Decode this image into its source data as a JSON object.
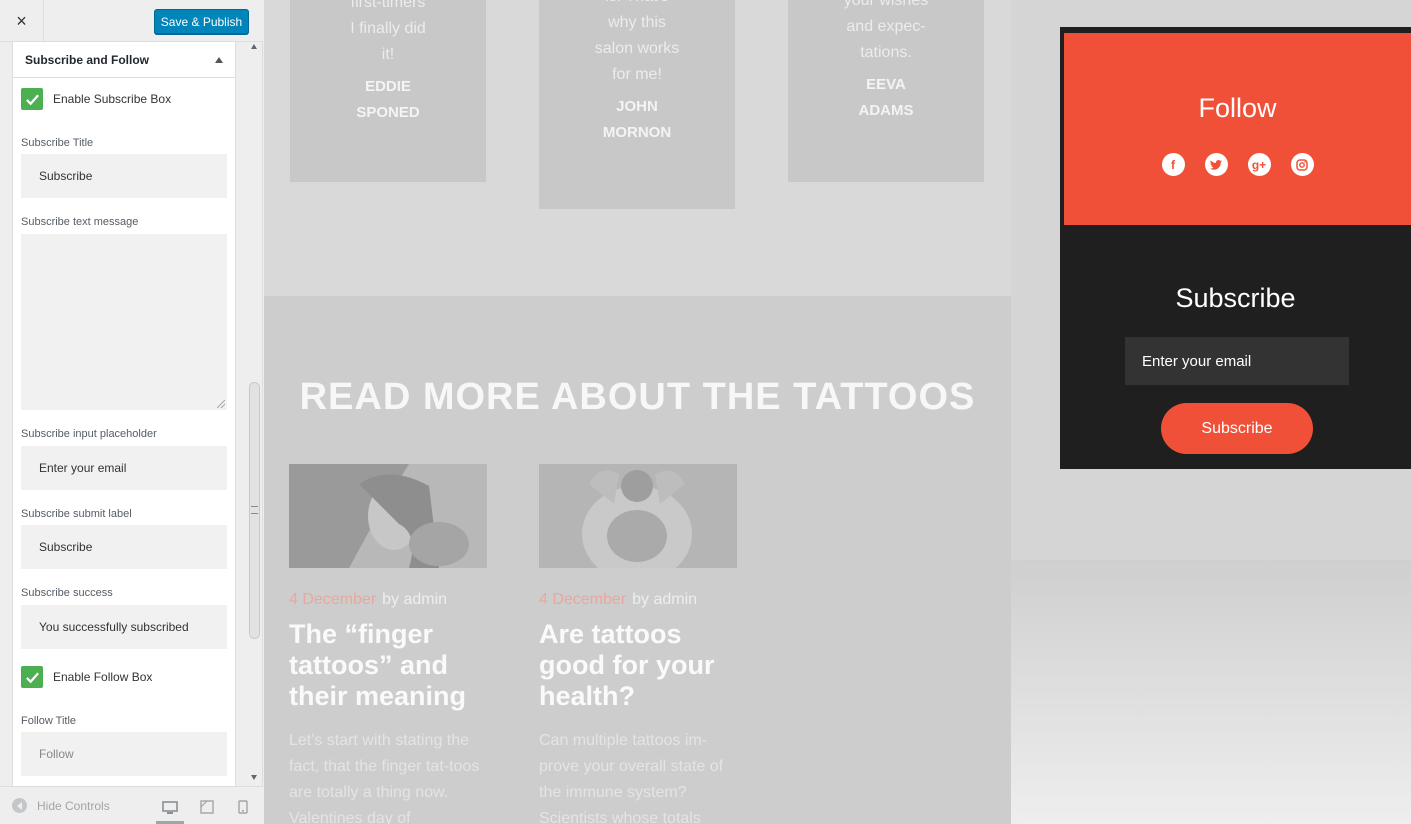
{
  "customizer": {
    "close_label": "×",
    "save_label": "Save & Publish",
    "section_title": "Subscribe and Follow",
    "enable_subscribe_label": "Enable Subscribe Box",
    "subscribe_title_label": "Subscribe Title",
    "subscribe_title_value": "Subscribe",
    "subscribe_text_label": "Subscribe text message",
    "subscribe_text_value": "",
    "input_placeholder_label": "Subscribe input placeholder",
    "input_placeholder_value": "Enter your email",
    "submit_label_label": "Subscribe submit label",
    "submit_label_value": "Subscribe",
    "success_label": "Subscribe success",
    "success_value": "You successfully subscribed",
    "enable_follow_label": "Enable Follow Box",
    "follow_title_label": "Follow Title",
    "follow_title_placeholder": "Follow",
    "hide_controls": "Hide Controls",
    "checkbox_color": "#4caf50",
    "save_color": "#0085ba"
  },
  "preview": {
    "testimonials": [
      {
        "text": [
          "first-timers",
          "I finally did",
          "it!"
        ],
        "name": [
          "EDDIE",
          "SPONED"
        ]
      },
      {
        "text": [
          "is. That's",
          "why this",
          "salon works",
          "for me!"
        ],
        "name": [
          "JOHN",
          "MORNON"
        ]
      },
      {
        "text": [
          "your wishes",
          "and expec-",
          "tations."
        ],
        "name": [
          "EEVA",
          "ADAMS"
        ]
      }
    ],
    "section_heading": "READ MORE ABOUT THE TATTOOS",
    "posts": [
      {
        "date": "4 December",
        "author": "by admin",
        "title": "The “finger tattoos” and their meaning",
        "excerpt": "Let's start with stating the fact, that the finger tat-toos are totally a thing now. Valentines day of"
      },
      {
        "date": "4 December",
        "author": "by admin",
        "title": "Are tattoos good for your health?",
        "excerpt": "Can multiple tattoos im-prove your overall state of the immune system? Scientists whose totals"
      }
    ]
  },
  "widget": {
    "follow_title": "Follow",
    "social": [
      "facebook-icon",
      "twitter-icon",
      "google-plus-icon",
      "instagram-icon"
    ],
    "subscribe_title": "Subscribe",
    "email_placeholder": "Enter your email",
    "subscribe_button": "Subscribe",
    "accent_color": "#f05038",
    "dark_color": "#1f1f1f"
  }
}
